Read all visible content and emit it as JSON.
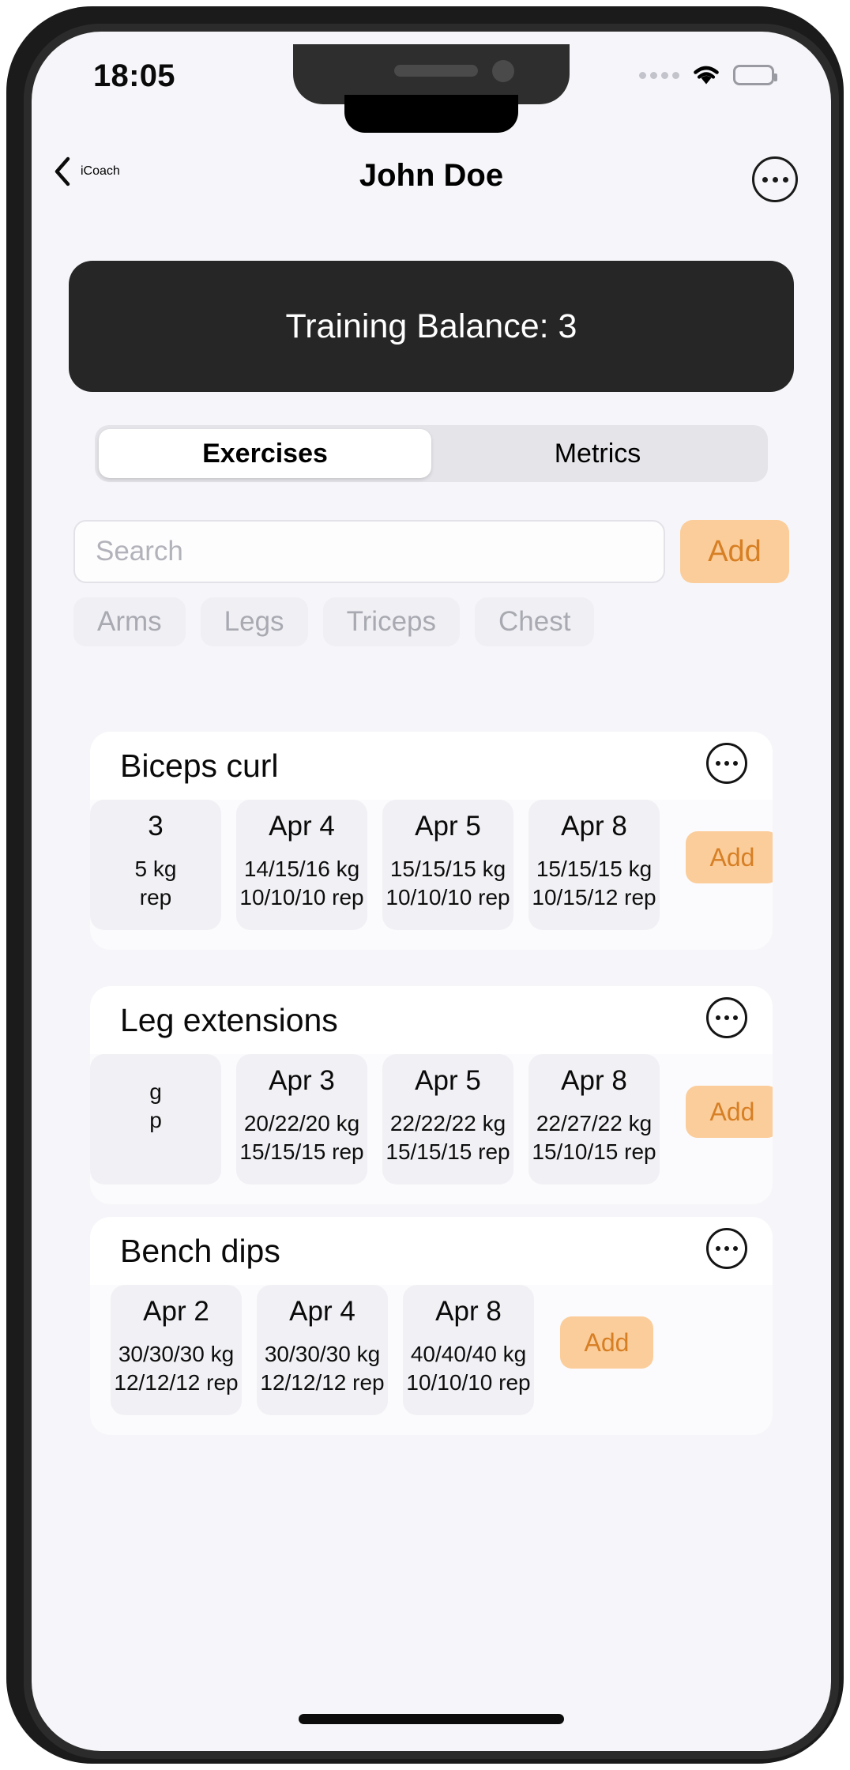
{
  "status_bar": {
    "time": "18:05",
    "signal_icon": "signal-dots-icon",
    "wifi_icon": "wifi-icon",
    "battery_icon": "battery-icon"
  },
  "nav": {
    "back_label": "iCoach",
    "back_icon": "chevron-left-icon",
    "title": "John Doe",
    "more_icon": "ellipsis-circle-icon"
  },
  "banner": {
    "text": "Training Balance: 3"
  },
  "tabs": [
    {
      "label": "Exercises",
      "active": true
    },
    {
      "label": "Metrics",
      "active": false
    }
  ],
  "search": {
    "value": "",
    "placeholder": "Search",
    "add_label": "Add"
  },
  "filters": [
    {
      "label": "Arms"
    },
    {
      "label": "Legs"
    },
    {
      "label": "Triceps"
    },
    {
      "label": "Chest"
    }
  ],
  "exercises": [
    {
      "name": "Biceps curl",
      "add_label": "Add",
      "sets": [
        {
          "date": "3",
          "weight": "5 kg",
          "reps": "rep",
          "partial": true
        },
        {
          "date": "Apr 4",
          "weight": "14/15/16 kg",
          "reps": "10/10/10 rep",
          "partial": false
        },
        {
          "date": "Apr 5",
          "weight": "15/15/15 kg",
          "reps": "10/10/10 rep",
          "partial": false
        },
        {
          "date": "Apr 8",
          "weight": "15/15/15 kg",
          "reps": "10/15/12 rep",
          "partial": false
        }
      ]
    },
    {
      "name": "Leg extensions",
      "add_label": "Add",
      "sets": [
        {
          "date": "",
          "weight": "g",
          "reps": "p",
          "partial": true
        },
        {
          "date": "Apr 3",
          "weight": "20/22/20 kg",
          "reps": "15/15/15 rep",
          "partial": false
        },
        {
          "date": "Apr 5",
          "weight": "22/22/22 kg",
          "reps": "15/15/15 rep",
          "partial": false
        },
        {
          "date": "Apr 8",
          "weight": "22/27/22 kg",
          "reps": "15/10/15 rep",
          "partial": false
        }
      ]
    },
    {
      "name": "Bench dips",
      "add_label": "Add",
      "sets": [
        {
          "date": "Apr 2",
          "weight": "30/30/30 kg",
          "reps": "12/12/12 rep",
          "partial": false
        },
        {
          "date": "Apr 4",
          "weight": "30/30/30 kg",
          "reps": "12/12/12 rep",
          "partial": false
        },
        {
          "date": "Apr 8",
          "weight": "40/40/40 kg",
          "reps": "10/10/10 rep",
          "partial": false
        }
      ]
    }
  ],
  "colors": {
    "accent": "#fbcd9a",
    "accent_text": "#d77f24",
    "banner_bg": "#262626",
    "screen_bg": "#f6f6fa"
  }
}
